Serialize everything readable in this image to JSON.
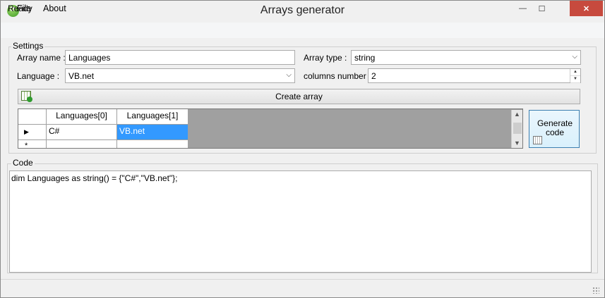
{
  "window": {
    "title": "Arrays generator",
    "app_icon": "gear-leaf-icon"
  },
  "controls": {
    "minimize": "—",
    "maximize": "☐",
    "close": "✕"
  },
  "menu": {
    "file": "File",
    "about": "About"
  },
  "settings": {
    "legend": "Settings",
    "array_name_label": "Array name :",
    "array_name_value": "Languages",
    "language_label": "Language :",
    "language_value": "VB.net",
    "array_type_label": "Array type :",
    "array_type_value": "string",
    "columns_label": "columns number :",
    "columns_value": "2",
    "create_button": "Create array"
  },
  "grid": {
    "columns": [
      "Languages[0]",
      "Languages[1]"
    ],
    "rows": [
      [
        "C#",
        "VB.net"
      ],
      [
        "",
        ""
      ]
    ],
    "row_marker": "▶",
    "new_row_marker": "*"
  },
  "generate_button": "Generate code",
  "code": {
    "legend": "Code",
    "text": "dim Languages as string() = {\"C#\",\"VB.net\"};"
  },
  "status": {
    "text": "Ready"
  },
  "colors": {
    "accent": "#3399ff",
    "close": "#c74a3e"
  }
}
